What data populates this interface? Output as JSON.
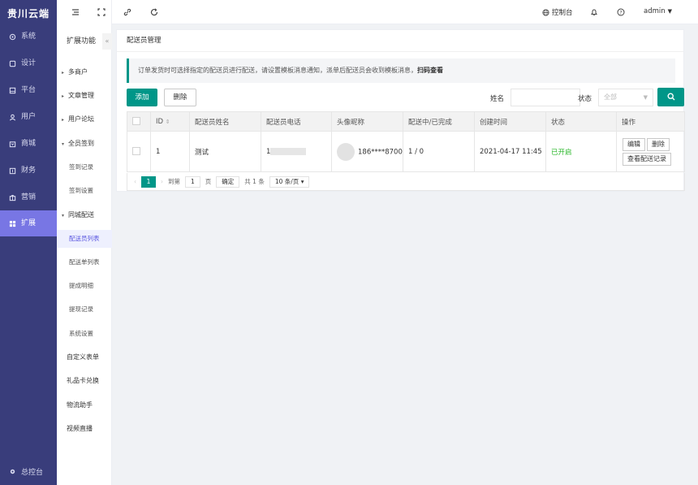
{
  "brand": "贵川云端",
  "sidebar": {
    "items": [
      {
        "label": "系统",
        "icon": "system-icon"
      },
      {
        "label": "设计",
        "icon": "design-icon"
      },
      {
        "label": "平台",
        "icon": "platform-icon"
      },
      {
        "label": "用户",
        "icon": "user-icon"
      },
      {
        "label": "商城",
        "icon": "mall-icon"
      },
      {
        "label": "财务",
        "icon": "finance-icon"
      },
      {
        "label": "营销",
        "icon": "marketing-icon"
      },
      {
        "label": "扩展",
        "icon": "extend-icon",
        "active": true
      }
    ],
    "bottom": "总控台"
  },
  "submenu": {
    "title": "扩展功能",
    "items": [
      "多商户",
      "文章管理",
      "用户论坛",
      "全员签到",
      "签到记录",
      "签到设置",
      "同城配送",
      "配送员列表",
      "配送单列表",
      "提成明细",
      "提现记录",
      "系统设置",
      "自定义表单",
      "礼品卡兑换",
      "物流助手",
      "视频直播"
    ]
  },
  "topbar": {
    "console": "控制台",
    "user": "admin"
  },
  "panel": {
    "title": "配送员管理",
    "notice": "订单发货时可选择指定的配送员进行配送，请设置模板消息通知，派单后配送员会收到模板消息，",
    "notice_link": "扫码查看",
    "add_label": "添加",
    "delete_label": "删除",
    "name_label": "姓名",
    "status_label": "状态",
    "status_value": "全部"
  },
  "table": {
    "headers": [
      "ID",
      "配送员姓名",
      "配送员电话",
      "头像昵称",
      "配送中/已完成",
      "创建时间",
      "状态",
      "操作"
    ],
    "rows": [
      {
        "id": "1",
        "name": "测试",
        "phone": "1",
        "nickname": "186****8700",
        "progress": "1 / 0",
        "created": "2021-04-17 11:45",
        "status": "已开启",
        "edit": "编辑",
        "delete": "删除",
        "records": "查看配送记录"
      }
    ]
  },
  "pager": {
    "current": "1",
    "goto": "到第",
    "page_input": "1",
    "page_unit": "页",
    "confirm": "确定",
    "total": "共 1 条",
    "page_size": "10 条/页"
  },
  "colors": {
    "sidebar": "#393d7b",
    "active": "#7876e4",
    "accent": "#009688",
    "status_on": "#2eb82e"
  }
}
